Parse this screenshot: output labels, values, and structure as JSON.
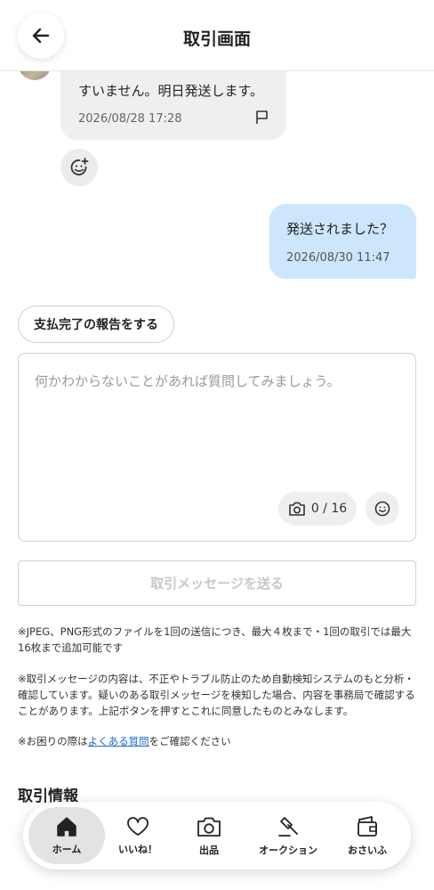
{
  "header": {
    "title": "取引画面"
  },
  "messages": {
    "received": {
      "text": "すいません。明日発送します。",
      "time": "2026/08/28 17:28"
    },
    "sent": {
      "text": "発送されました？",
      "time": "2026/08/30 11:47"
    }
  },
  "actions": {
    "pay_report": "支払完了の報告をする",
    "send": "取引メッセージを送る"
  },
  "composer": {
    "placeholder": "何かわからないことがあれば質問してみましょう。",
    "photo_count": "0 / 16"
  },
  "notes": {
    "note1": "※JPEG、PNG形式のファイルを1回の送信につき、最大４枚まで・1回の取引では最大16枚まで追加可能です",
    "note2": "※取引メッセージの内容は、不正やトラブル防止のため自動検知システムのもと分析・確認しています。疑いのある取引メッセージを検知した場合、内容を事務局で確認することがあります。上記ボタンを押すとこれに同意したものとみなします。",
    "note3_prefix": "※お困りの際は",
    "note3_link": "よくある質問",
    "note3_suffix": "をご確認ください"
  },
  "section": {
    "title": "取引情報"
  },
  "tabbar": {
    "items": [
      {
        "label": "ホーム",
        "icon": "home-icon",
        "active": true
      },
      {
        "label": "いいね！",
        "icon": "heart-icon",
        "active": false
      },
      {
        "label": "出品",
        "icon": "camera-icon",
        "active": false
      },
      {
        "label": "オークション",
        "icon": "gavel-icon",
        "active": false
      },
      {
        "label": "おさいふ",
        "icon": "wallet-icon",
        "active": false
      }
    ]
  },
  "colors": {
    "accent_link": "#1a6fc9",
    "sent_bubble": "#cde6fb",
    "received_bubble": "#efefef"
  }
}
